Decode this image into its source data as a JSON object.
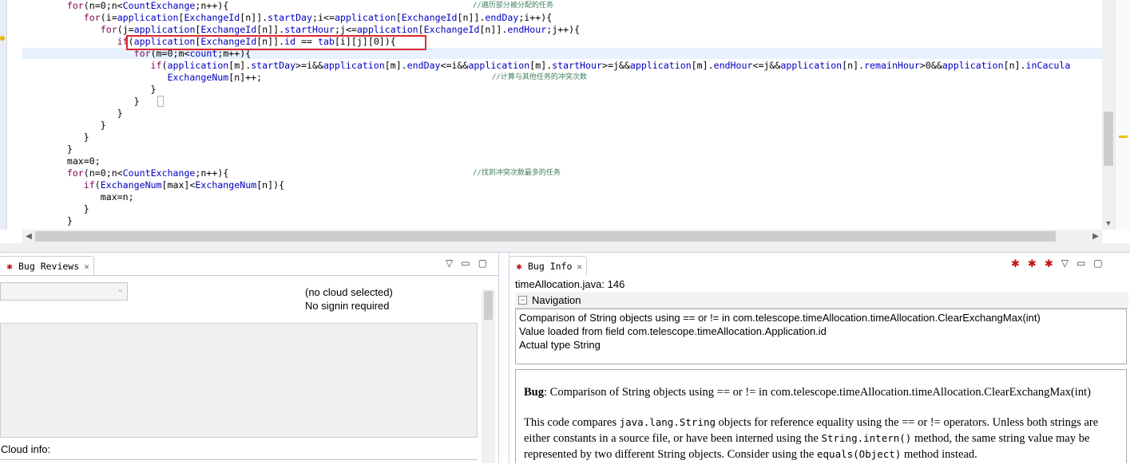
{
  "editor": {
    "lines": [
      {
        "indent": "        ",
        "segs": [
          {
            "t": "for",
            "c": "kw"
          },
          {
            "t": "(n=0;n<"
          },
          {
            "t": "CountExchange",
            "c": "fld"
          },
          {
            "t": ";n++){"
          }
        ],
        "comment": "//遍历部分被分配的任务",
        "ccol": 592
      },
      {
        "indent": "           ",
        "segs": [
          {
            "t": "for",
            "c": "kw"
          },
          {
            "t": "(i="
          },
          {
            "t": "application",
            "c": "fld"
          },
          {
            "t": "["
          },
          {
            "t": "ExchangeId",
            "c": "fld"
          },
          {
            "t": "[n]]."
          },
          {
            "t": "startDay",
            "c": "fld"
          },
          {
            "t": ";i<="
          },
          {
            "t": "application",
            "c": "fld"
          },
          {
            "t": "["
          },
          {
            "t": "ExchangeId",
            "c": "fld"
          },
          {
            "t": "[n]]."
          },
          {
            "t": "endDay",
            "c": "fld"
          },
          {
            "t": ";i++){"
          }
        ]
      },
      {
        "indent": "              ",
        "segs": [
          {
            "t": "for",
            "c": "kw"
          },
          {
            "t": "(j="
          },
          {
            "t": "application",
            "c": "fld"
          },
          {
            "t": "["
          },
          {
            "t": "ExchangeId",
            "c": "fld"
          },
          {
            "t": "[n]]."
          },
          {
            "t": "startHour",
            "c": "fld"
          },
          {
            "t": ";j<="
          },
          {
            "t": "application",
            "c": "fld"
          },
          {
            "t": "["
          },
          {
            "t": "ExchangeId",
            "c": "fld"
          },
          {
            "t": "[n]]."
          },
          {
            "t": "endHour",
            "c": "fld"
          },
          {
            "t": ";j++){"
          }
        ]
      },
      {
        "indent": "                 ",
        "segs": [
          {
            "t": "if",
            "c": "kw"
          },
          {
            "t": "("
          },
          {
            "t": "application",
            "c": "fld"
          },
          {
            "t": "["
          },
          {
            "t": "ExchangeId",
            "c": "fld"
          },
          {
            "t": "[n]]."
          },
          {
            "t": "id",
            "c": "fld"
          },
          {
            "t": " == "
          },
          {
            "t": "tab",
            "c": "fld"
          },
          {
            "t": "[i][j][0]){"
          }
        ]
      },
      {
        "indent": "                    ",
        "segs": [
          {
            "t": "for",
            "c": "kw"
          },
          {
            "t": "(m=0;m<"
          },
          {
            "t": "count",
            "c": "fld"
          },
          {
            "t": ";m++){"
          }
        ]
      },
      {
        "indent": "                       ",
        "segs": [
          {
            "t": "if",
            "c": "kw"
          },
          {
            "t": "("
          },
          {
            "t": "application",
            "c": "fld"
          },
          {
            "t": "[m]."
          },
          {
            "t": "startDay",
            "c": "fld"
          },
          {
            "t": ">=i&&"
          },
          {
            "t": "application",
            "c": "fld"
          },
          {
            "t": "[m]."
          },
          {
            "t": "endDay",
            "c": "fld"
          },
          {
            "t": "<=i&&"
          },
          {
            "t": "application",
            "c": "fld"
          },
          {
            "t": "[m]."
          },
          {
            "t": "startHour",
            "c": "fld"
          },
          {
            "t": ">=j&&"
          },
          {
            "t": "application",
            "c": "fld"
          },
          {
            "t": "[m]."
          },
          {
            "t": "endHour",
            "c": "fld"
          },
          {
            "t": "<=j&&"
          },
          {
            "t": "application",
            "c": "fld"
          },
          {
            "t": "[n]."
          },
          {
            "t": "remainHour",
            "c": "fld"
          },
          {
            "t": ">0&&"
          },
          {
            "t": "application",
            "c": "fld"
          },
          {
            "t": "[n]."
          },
          {
            "t": "inCacula",
            "c": "fld"
          }
        ]
      },
      {
        "indent": "                          ",
        "segs": [
          {
            "t": "ExchangeNum",
            "c": "fld"
          },
          {
            "t": "[n]++;"
          }
        ],
        "comment": "//计算与其他任务的冲突次数",
        "ccol": 616
      },
      {
        "indent": "                       ",
        "segs": [
          {
            "t": "}"
          }
        ]
      },
      {
        "indent": "                    ",
        "segs": [
          {
            "t": "}"
          }
        ]
      },
      {
        "indent": "                 ",
        "segs": [
          {
            "t": "}"
          }
        ]
      },
      {
        "indent": "              ",
        "segs": [
          {
            "t": "}"
          }
        ]
      },
      {
        "indent": "           ",
        "segs": [
          {
            "t": "}"
          }
        ]
      },
      {
        "indent": "        ",
        "segs": [
          {
            "t": "}"
          }
        ]
      },
      {
        "indent": "        ",
        "segs": [
          {
            "t": "max=0;"
          }
        ]
      },
      {
        "indent": "        ",
        "segs": [
          {
            "t": "for",
            "c": "kw"
          },
          {
            "t": "(n=0;n<"
          },
          {
            "t": "CountExchange",
            "c": "fld"
          },
          {
            "t": ";n++){"
          }
        ],
        "comment": "//找到冲突次数最多的任务",
        "ccol": 592
      },
      {
        "indent": "           ",
        "segs": [
          {
            "t": "if",
            "c": "kw"
          },
          {
            "t": "("
          },
          {
            "t": "ExchangeNum",
            "c": "fld"
          },
          {
            "t": "[max]<"
          },
          {
            "t": "ExchangeNum",
            "c": "fld"
          },
          {
            "t": "[n]){"
          }
        ]
      },
      {
        "indent": "              ",
        "segs": [
          {
            "t": "max=n;"
          }
        ]
      },
      {
        "indent": "           ",
        "segs": [
          {
            "t": "}"
          }
        ]
      },
      {
        "indent": "        ",
        "segs": [
          {
            "t": "}"
          }
        ]
      }
    ]
  },
  "bug_reviews": {
    "tab_label": "Bug Reviews",
    "cloud_status": "(no cloud selected)",
    "signin_status": "No signin required",
    "cloud_info_label": "Cloud info:"
  },
  "bug_info": {
    "tab_label": "Bug Info",
    "location": "timeAllocation.java: 146",
    "navigation_label": "Navigation",
    "navigation_items": [
      "Comparison of String objects using == or != in com.telescope.timeAllocation.timeAllocation.ClearExchangMax(int)",
      "Value loaded from field com.telescope.timeAllocation.Application.id",
      "Actual type String"
    ],
    "desc_bug_label": "Bug",
    "desc_title": ": Comparison of String objects using == or != in com.telescope.timeAllocation.timeAllocation.ClearExchangMax(int)",
    "desc_p2_a": "This code compares ",
    "desc_p2_code1": "java.lang.String",
    "desc_p2_b": " objects for reference equality using the == or != operators. Unless both strings are either constants in a source file, or have been interned using the ",
    "desc_p2_code2": "String.intern()",
    "desc_p2_c": " method, the same string value may be represented by two different String objects. Consider using the ",
    "desc_p2_code3": "equals(Object)",
    "desc_p2_d": " method instead."
  },
  "colors": {
    "keyword": "#7f0055",
    "field": "#0000c0",
    "comment": "#3f7f5f",
    "highlight_box": "#e0262c"
  },
  "icons": {
    "bug_reviews_tab": "bug-icon",
    "bug_info_tab": "bug-icon",
    "close": "close-icon",
    "menu": "view-menu-icon",
    "minimize": "minimize-icon",
    "maximize": "maximize-icon"
  }
}
